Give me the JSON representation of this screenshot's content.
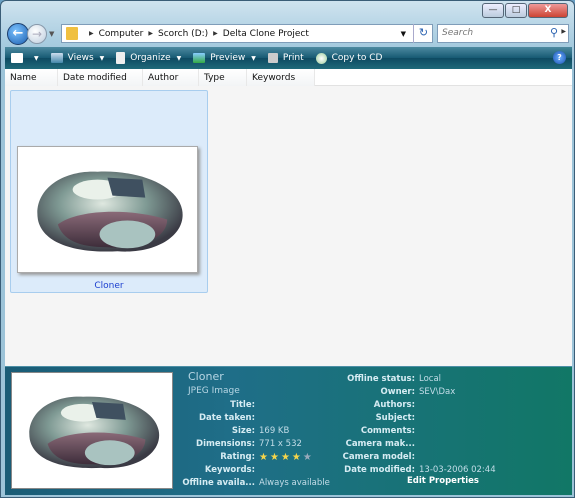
{
  "window": {
    "minimize": "—",
    "maximize": "□",
    "close": "X"
  },
  "address": {
    "crumbs": [
      "Computer",
      "Scorch (D:)",
      "Delta Clone Project"
    ],
    "search_placeholder": "Search"
  },
  "toolbar": {
    "views": "Views",
    "organize": "Organize",
    "preview": "Preview",
    "print": "Print",
    "copy_to_cd": "Copy to CD",
    "help": "?"
  },
  "columns": [
    "Name",
    "Date modified",
    "Author",
    "Type",
    "Keywords"
  ],
  "files": [
    {
      "name": "Cloner"
    }
  ],
  "details": {
    "name": "Cloner",
    "type": "JPEG Image",
    "left": [
      {
        "k": "Title:",
        "v": ""
      },
      {
        "k": "Date taken:",
        "v": ""
      },
      {
        "k": "Size:",
        "v": "169 KB"
      },
      {
        "k": "Dimensions:",
        "v": "771 x 532"
      },
      {
        "k": "Rating:",
        "v": ""
      },
      {
        "k": "Keywords:",
        "v": ""
      },
      {
        "k": "Offline availa...",
        "v": "Always available"
      }
    ],
    "right": [
      {
        "k": "Offline status:",
        "v": "Local"
      },
      {
        "k": "Owner:",
        "v": "SEV\\Dax"
      },
      {
        "k": "Authors:",
        "v": ""
      },
      {
        "k": "Subject:",
        "v": ""
      },
      {
        "k": "Comments:",
        "v": ""
      },
      {
        "k": "Camera mak...",
        "v": ""
      },
      {
        "k": "Camera model:",
        "v": ""
      },
      {
        "k": "Date modified:",
        "v": "13-03-2006 02:44"
      }
    ],
    "rating": 4,
    "rating_max": 5,
    "edit_properties": "Edit Properties"
  }
}
